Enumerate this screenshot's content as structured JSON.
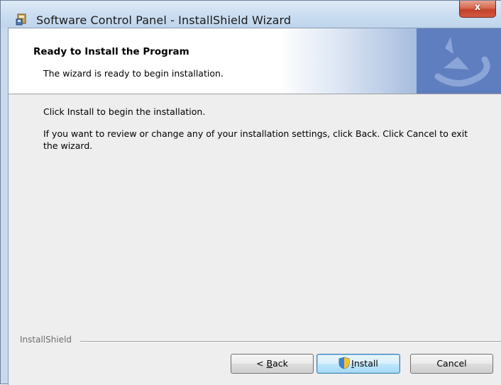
{
  "window": {
    "title": "Software Control Panel - InstallShield Wizard",
    "close_label": "x"
  },
  "header": {
    "title": "Ready to Install the Program",
    "subtitle": "The wizard is ready to begin installation."
  },
  "body": {
    "line1": "Click Install to begin the installation.",
    "line2": "If you want to review or change any of your installation settings, click Back. Click Cancel to exit the wizard."
  },
  "footer": {
    "brand": "InstallShield"
  },
  "buttons": {
    "back_prefix": "< ",
    "back_mnemonic": "B",
    "back_rest": "ack",
    "install_mnemonic": "I",
    "install_rest": "nstall",
    "cancel": "Cancel"
  },
  "icons": {
    "app": "installer-icon",
    "logo": "installshield-logo",
    "uac": "uac-shield-icon"
  },
  "colors": {
    "close_button": "#c4412a",
    "header_logo_blue": "#5f7ec0",
    "default_button_border": "#3c7fb1"
  }
}
